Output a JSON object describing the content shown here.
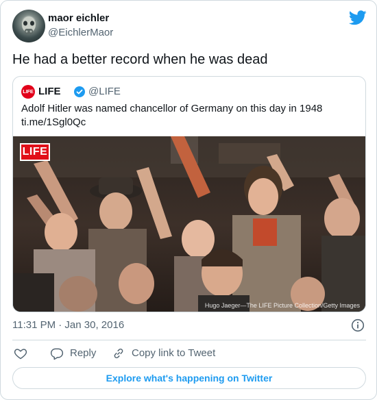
{
  "author": {
    "name": "maor eichler",
    "handle": "@EichlerMaor"
  },
  "tweet": {
    "text": "He had a better record when he was dead",
    "timestamp": "11:31 PM · Jan 30, 2016"
  },
  "quoted": {
    "logo_text": "LIFE",
    "name": "LIFE",
    "handle": "@LIFE",
    "text_line1": "Adolf Hitler was named chancellor of Germany on this day in 1948",
    "text_line2": "ti.me/1Sgl0Qc",
    "image_badge": "LIFE",
    "image_credit": "Hugo Jaeger—The LIFE Picture Collection/Getty Images"
  },
  "actions": {
    "reply_label": "Reply",
    "copy_label": "Copy link to Tweet"
  },
  "explore_label": "Explore what's happening on Twitter",
  "colors": {
    "accent": "#1d9bf0",
    "text": "#0f1419",
    "muted": "#536471",
    "border": "#cfd9de",
    "life_red": "#e10f19"
  },
  "icons": [
    "twitter-bird-icon",
    "verified-badge-icon",
    "info-icon",
    "heart-icon",
    "reply-bubble-icon",
    "link-icon"
  ]
}
